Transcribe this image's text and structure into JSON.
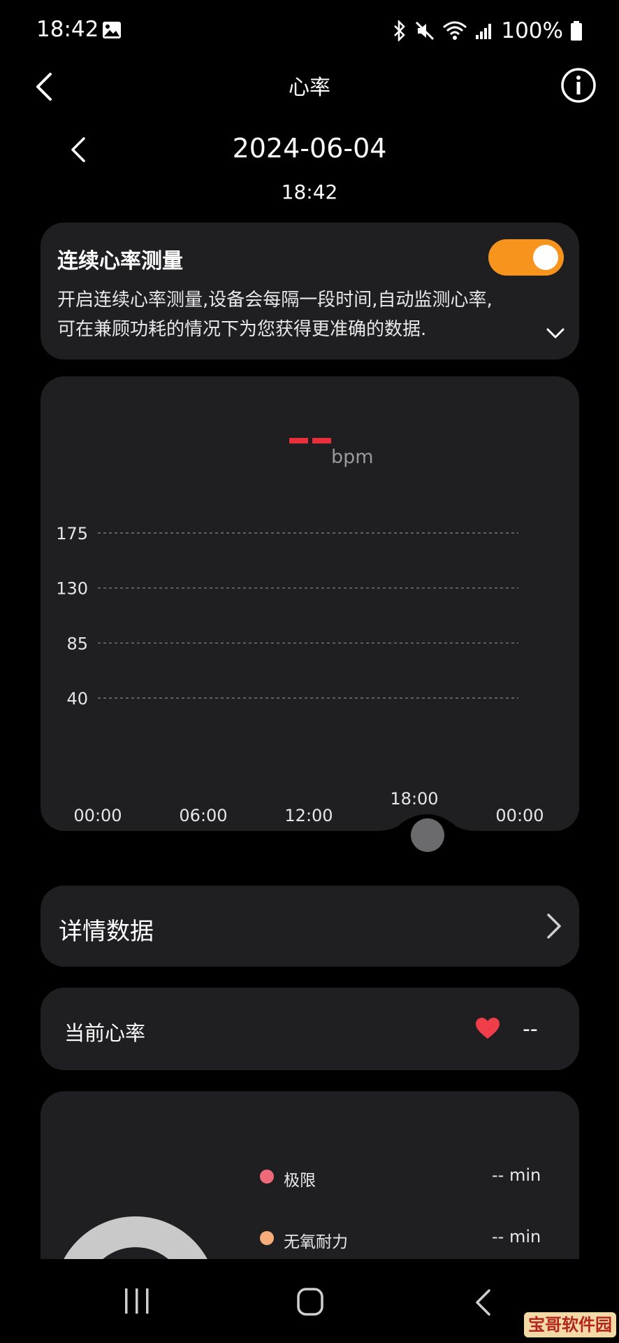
{
  "status_bar": {
    "time": "18:42",
    "battery": "100%",
    "icons": [
      "gallery-icon",
      "bluetooth-icon",
      "mute-icon",
      "wifi-icon",
      "signal-icon",
      "battery-icon"
    ]
  },
  "header": {
    "title": "心率",
    "back_icon": "back-chevron-icon",
    "info_icon": "info-icon"
  },
  "date_nav": {
    "date": "2024-06-04",
    "time": "18:42"
  },
  "continuous": {
    "title": "连续心率测量",
    "toggle_on": true,
    "description_line1": "开启连续心率测量,设备会每隔一段时间,自动监测心率,",
    "description_line2": "可在兼顾功耗的情况下为您获得更准确的数据.",
    "accent_color": "#f7941d"
  },
  "chart": {
    "current_value": "--",
    "unit": "bpm"
  },
  "chart_data": {
    "type": "line",
    "title": "",
    "xlabel": "",
    "ylabel": "",
    "x_ticks": [
      "00:00",
      "06:00",
      "12:00",
      "18:00",
      "00:00"
    ],
    "y_ticks": [
      175,
      130,
      85,
      40
    ],
    "ylim": [
      40,
      175
    ],
    "grid": true,
    "series": [],
    "selected_time": "18:00",
    "cursor_color": "#e8303d"
  },
  "detail": {
    "label": "详情数据"
  },
  "current": {
    "label": "当前心率",
    "value": "--"
  },
  "zones": [
    {
      "name": "极限",
      "value": "-- min",
      "color": "#ef6a78"
    },
    {
      "name": "无氧耐力",
      "value": "-- min",
      "color": "#f7ad7a"
    }
  ],
  "watermark": "宝哥软件园"
}
